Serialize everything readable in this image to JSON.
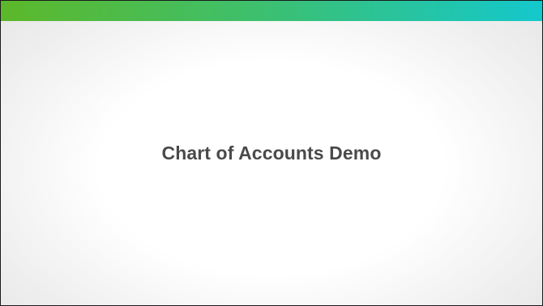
{
  "slide": {
    "title": "Chart of Accounts Demo"
  },
  "theme": {
    "bar_gradient_start": "#5cb82a",
    "bar_gradient_end": "#14c8cc",
    "title_color": "#4a4a4a",
    "border_color": "#1a1a1a"
  }
}
